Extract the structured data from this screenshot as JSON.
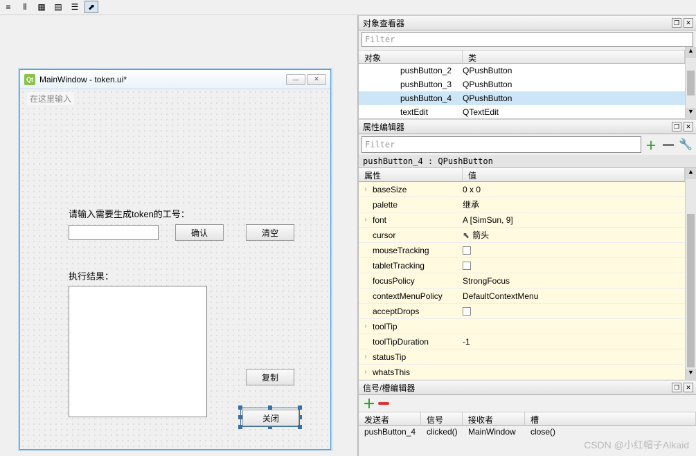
{
  "toolbar_icons": [
    "layout-h",
    "layout-v",
    "grid-3",
    "grid-4",
    "rows",
    "pointer"
  ],
  "preview": {
    "title": "MainWindow - token.ui*",
    "type_here": "在这里输入",
    "label_input": "请输入需要生成token的工号：",
    "btn_confirm": "确认",
    "btn_clear": "清空",
    "label_result": "执行结果：",
    "btn_copy": "复制",
    "btn_close": "关闭"
  },
  "inspector": {
    "title": "对象查看器",
    "filter_placeholder": "Filter",
    "col_object": "对象",
    "col_class": "类",
    "rows": [
      {
        "name": "pushButton_2",
        "cls": "QPushButton",
        "sel": false
      },
      {
        "name": "pushButton_3",
        "cls": "QPushButton",
        "sel": false
      },
      {
        "name": "pushButton_4",
        "cls": "QPushButton",
        "sel": true
      },
      {
        "name": "textEdit",
        "cls": "QTextEdit",
        "sel": false
      }
    ]
  },
  "prop_editor": {
    "title": "属性编辑器",
    "filter_placeholder": "Filter",
    "context": "pushButton_4 : QPushButton",
    "col_name": "属性",
    "col_value": "值",
    "rows": [
      {
        "exp": "›",
        "name": "baseSize",
        "value": "0 x 0",
        "yellow": true
      },
      {
        "exp": "",
        "name": "palette",
        "value": "继承",
        "yellow": true
      },
      {
        "exp": "›",
        "name": "font",
        "value": "A  [SimSun, 9]",
        "yellow": true
      },
      {
        "exp": "",
        "name": "cursor",
        "value": "箭头",
        "yellow": true,
        "icon": "cursor"
      },
      {
        "exp": "",
        "name": "mouseTracking",
        "value": "",
        "yellow": true,
        "checkbox": true
      },
      {
        "exp": "",
        "name": "tabletTracking",
        "value": "",
        "yellow": true,
        "checkbox": true
      },
      {
        "exp": "",
        "name": "focusPolicy",
        "value": "StrongFocus",
        "yellow": true
      },
      {
        "exp": "",
        "name": "contextMenuPolicy",
        "value": "DefaultContextMenu",
        "yellow": true
      },
      {
        "exp": "",
        "name": "acceptDrops",
        "value": "",
        "yellow": true,
        "checkbox": true
      },
      {
        "exp": "›",
        "name": "toolTip",
        "value": "",
        "yellow": true
      },
      {
        "exp": "",
        "name": "toolTipDuration",
        "value": "-1",
        "yellow": true
      },
      {
        "exp": "›",
        "name": "statusTip",
        "value": "",
        "yellow": true
      },
      {
        "exp": "›",
        "name": "whatsThis",
        "value": "",
        "yellow": true
      }
    ]
  },
  "sig_editor": {
    "title": "信号/槽编辑器",
    "col_sender": "发送者",
    "col_signal": "信号",
    "col_receiver": "接收者",
    "col_slot": "槽",
    "rows": [
      {
        "sender": "pushButton_4",
        "signal": "clicked()",
        "receiver": "MainWindow",
        "slot": "close()"
      }
    ]
  },
  "watermark": "CSDN @小红帽子Alkaid"
}
